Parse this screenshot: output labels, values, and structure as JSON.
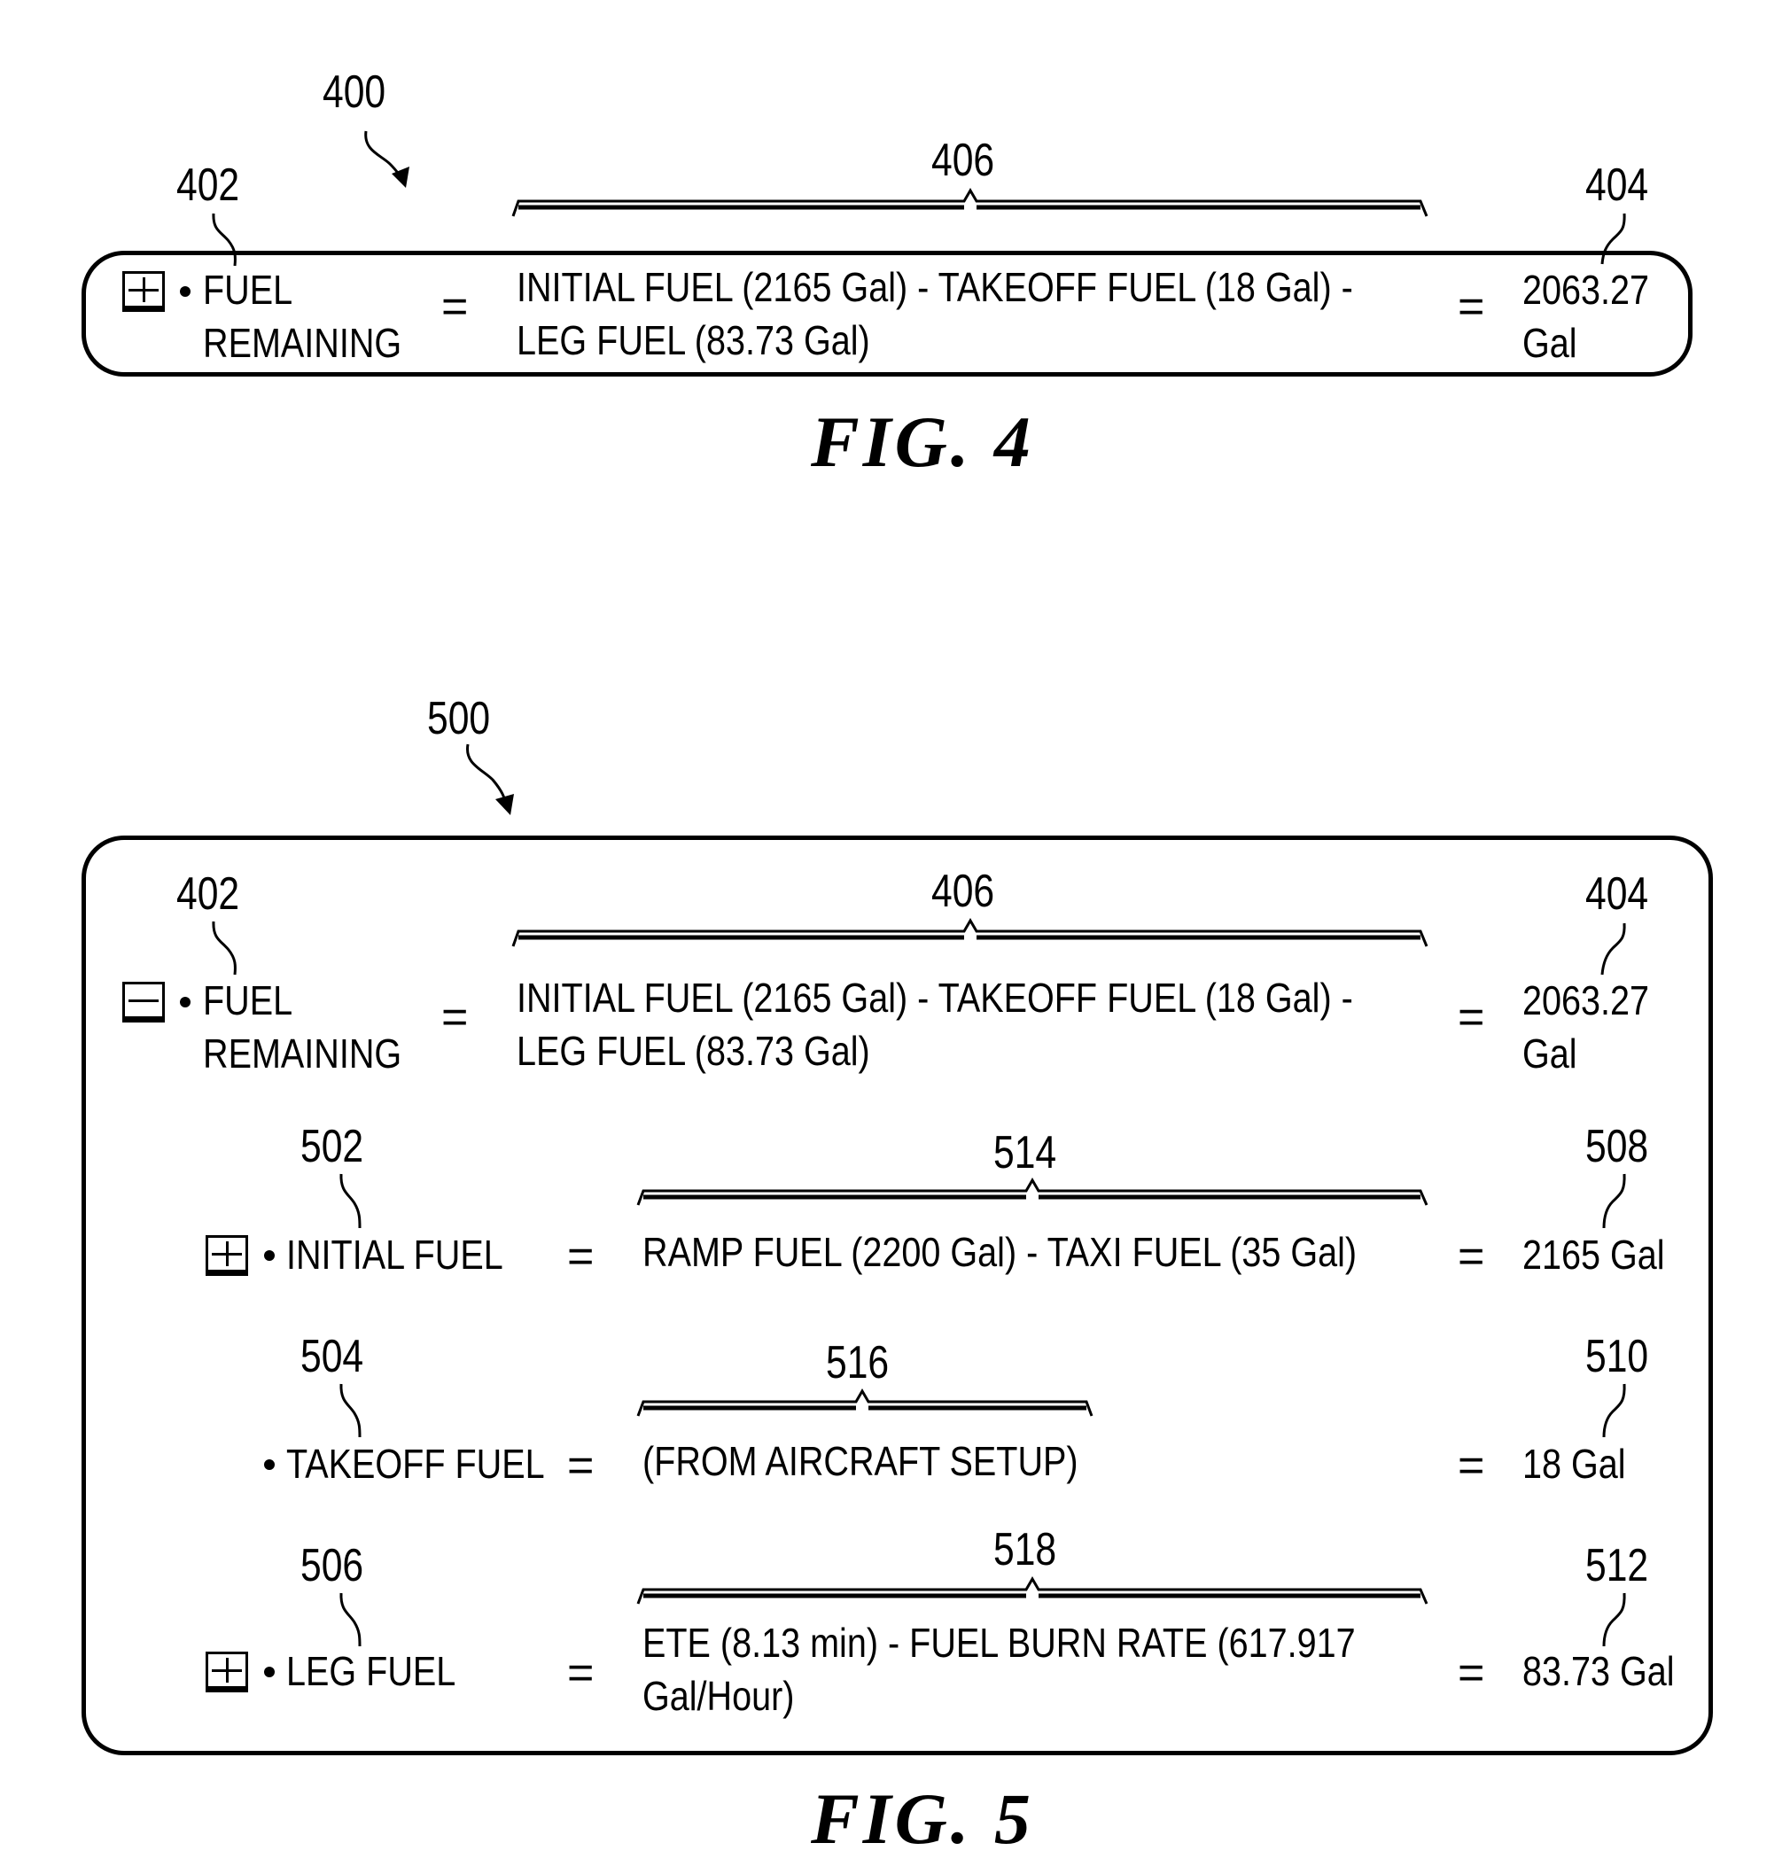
{
  "figures": [
    {
      "caption": "FIG. 4",
      "ref": "400",
      "rows": [
        {
          "ref_label": "402",
          "ref_formula": "406",
          "ref_result": "404",
          "toggle": "expand",
          "label_line1": "FUEL",
          "label_line2": "REMAINING",
          "equals": "=",
          "formula_line1": "INITIAL FUEL (2165 Gal) - TAKEOFF FUEL (18 Gal) -",
          "formula_line2": "LEG FUEL (83.73 Gal)",
          "result_line1": "2063.27",
          "result_line2": "Gal"
        }
      ]
    },
    {
      "caption": "FIG. 5",
      "ref": "500",
      "rows": [
        {
          "ref_label": "402",
          "ref_formula": "406",
          "ref_result": "404",
          "toggle": "collapse",
          "label_line1": "FUEL",
          "label_line2": "REMAINING",
          "equals": "=",
          "formula_line1": "INITIAL FUEL (2165 Gal) - TAKEOFF FUEL (18 Gal) -",
          "formula_line2": "LEG FUEL (83.73 Gal)",
          "result_line1": "2063.27",
          "result_line2": "Gal"
        },
        {
          "ref_label": "502",
          "ref_formula": "514",
          "ref_result": "508",
          "toggle": "expand",
          "label": "INITIAL FUEL",
          "equals": "=",
          "formula_line1": "RAMP FUEL (2200 Gal) - TAXI FUEL (35 Gal)",
          "equals_result": "=",
          "result": "2165 Gal"
        },
        {
          "ref_label": "504",
          "ref_formula": "516",
          "ref_result": "510",
          "toggle": "none",
          "label": "TAKEOFF FUEL",
          "equals": "=",
          "formula_line1": "(FROM AIRCRAFT SETUP)",
          "equals_result": "=",
          "result": "18 Gal"
        },
        {
          "ref_label": "506",
          "ref_formula": "518",
          "ref_result": "512",
          "toggle": "expand",
          "label": "LEG FUEL",
          "equals": "=",
          "formula_line1": "ETE (8.13 min) - FUEL BURN RATE (617.917",
          "formula_line2": "Gal/Hour)",
          "equals_result": "=",
          "result": "83.73 Gal"
        }
      ]
    }
  ],
  "icons": {
    "expand": "plus-box-icon",
    "collapse": "minus-box-icon",
    "bullet": "bullet-icon"
  }
}
